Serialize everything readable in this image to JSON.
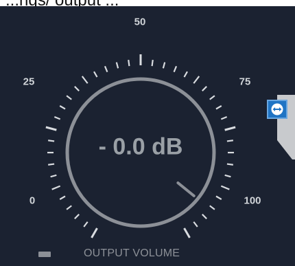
{
  "caption": "...ngs/ output ...",
  "knob": {
    "readout": "- 0.0 dB",
    "value_fraction": 0.93,
    "scale_labels": [
      "0",
      "25",
      "50",
      "75",
      "100"
    ]
  },
  "footer": {
    "label": "OUTPUT VOLUME"
  },
  "side_tab": {
    "icon": "teamviewer-icon"
  },
  "colors": {
    "panel": "#1b2231",
    "ring": "#8c9097",
    "ticks": "#d9dce0",
    "labels": "#d0d4d8",
    "accent": "#1f74c4"
  }
}
